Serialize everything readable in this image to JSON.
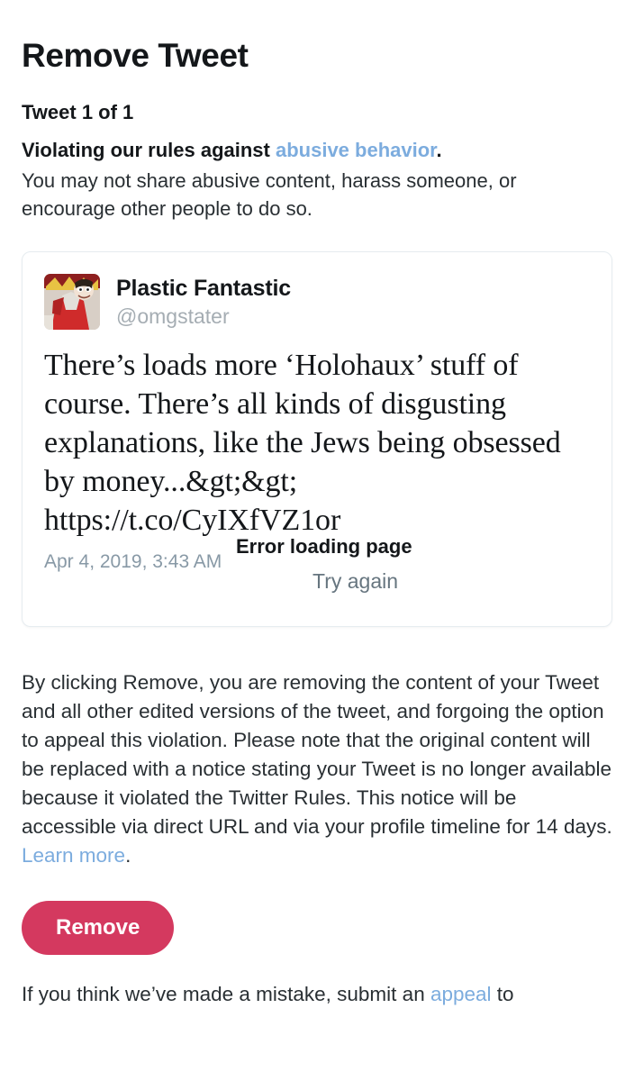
{
  "page": {
    "title": "Remove Tweet"
  },
  "violation": {
    "counter": "Tweet 1 of 1",
    "headline_prefix": "Violating our rules against ",
    "rule_link": "abusive behavior",
    "headline_suffix": ".",
    "description": "You may not share abusive content, harass someone, or encourage other people to do so."
  },
  "tweet": {
    "avatar_alt": "user-avatar",
    "display_name": "Plastic Fantastic",
    "handle": "@omgstater",
    "body": "There’s loads more ‘Holohaux’ stuff of course. There’s all kinds of disgusting explanations, like the Jews being obsessed by money...&gt;&gt; https://t.co/CyIXfVZ1or",
    "date": "Apr 4, 2019, 3:43 AM",
    "error_title": "Error loading page",
    "error_retry": "Try again"
  },
  "disclaimer": {
    "text": "By clicking Remove, you are removing the content of your Tweet and all other edited versions of the tweet, and forgoing the option to appeal this violation. Please note that the original content will be replaced with a notice stating your Tweet is no longer available because it violated the Twitter Rules. This notice will be accessible via direct URL and via your profile timeline for 14 days. ",
    "learn_more": "Learn more",
    "learn_more_suffix": "."
  },
  "actions": {
    "remove_label": "Remove"
  },
  "footer": {
    "appeal_prefix": "If you think we’ve made a mistake, submit an ",
    "appeal_link": "appeal",
    "appeal_suffix": " to"
  },
  "colors": {
    "link_blue": "#7cacde",
    "remove_button": "#d4395f",
    "card_border": "#e6ecf0",
    "handle_grey": "#a5adb3",
    "retry_grey": "#66757f",
    "date_grey": "#8899a6",
    "text_dark": "#14171a",
    "background": "#ffffff"
  }
}
